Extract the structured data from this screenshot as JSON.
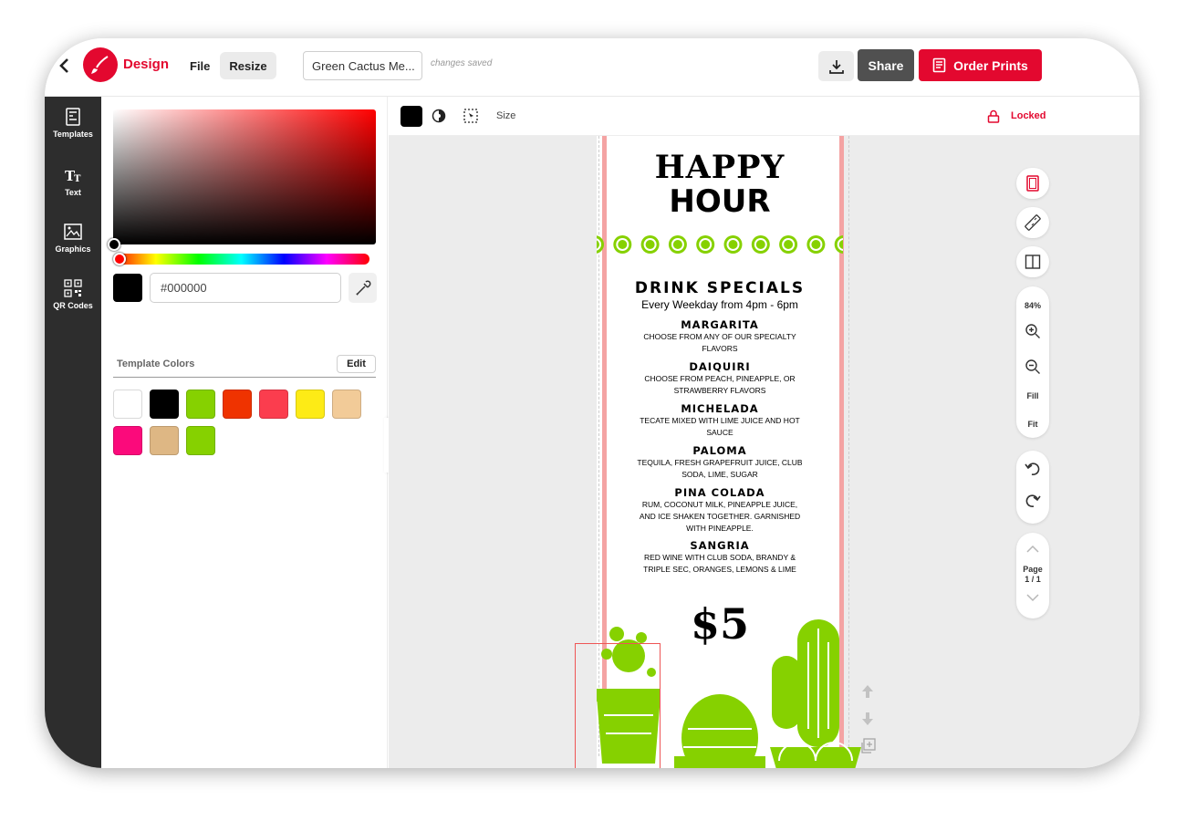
{
  "header": {
    "app_label": "Design",
    "file_label": "File",
    "resize_label": "Resize",
    "document_name": "Green Cactus Me...",
    "save_status": "changes saved",
    "share_label": "Share",
    "order_label": "Order Prints"
  },
  "sidebar": {
    "items": [
      {
        "label": "Templates",
        "icon": "templates-icon"
      },
      {
        "label": "Text",
        "icon": "text-icon"
      },
      {
        "label": "Graphics",
        "icon": "graphics-icon"
      },
      {
        "label": "QR Codes",
        "icon": "qr-code-icon"
      }
    ]
  },
  "color_panel": {
    "hex_value": "#000000",
    "current_color": "#000000",
    "template_colors_label": "Template Colors",
    "edit_label": "Edit",
    "template_colors": [
      "#ffffff",
      "#000000",
      "#86d100",
      "#ef3300",
      "#fb3d4e",
      "#fdeb16",
      "#f2cb98",
      "#fb0a7b",
      "#deb784",
      "#86d100"
    ]
  },
  "toolbar": {
    "size_label": "Size",
    "locked_label": "Locked"
  },
  "zoom": {
    "level": "84%",
    "fill_label": "Fill",
    "fit_label": "Fit",
    "page_label": "Page",
    "page_count": "1 / 1"
  },
  "menu": {
    "title_line1": "HAPPY",
    "title_line2": "HOUR",
    "heading": "DRINK SPECIALS",
    "subheading": "Every Weekday from 4pm - 6pm",
    "drinks": [
      {
        "name": "MARGARITA",
        "desc": "CHOOSE FROM ANY OF OUR SPECIALTY FLAVORS"
      },
      {
        "name": "DAIQUIRI",
        "desc": "CHOOSE FROM PEACH, PINEAPPLE, OR STRAWBERRY FLAVORS"
      },
      {
        "name": "MICHELADA",
        "desc": "TECATE MIXED WITH LIME JUICE AND HOT SAUCE"
      },
      {
        "name": "PALOMA",
        "desc": "TEQUILA, FRESH GRAPEFRUIT JUICE, CLUB SODA, LIME, SUGAR"
      },
      {
        "name": "PINA COLADA",
        "desc": "RUM, COCONUT MILK, PINEAPPLE JUICE, AND ICE SHAKEN TOGETHER. GARNISHED WITH PINEAPPLE."
      },
      {
        "name": "SANGRIA",
        "desc": "RED WINE WITH CLUB SODA, BRANDY & TRIPLE SEC, ORANGES, LEMONS & LIME"
      }
    ],
    "price": "$5"
  },
  "colors": {
    "brand": "#e3082f",
    "cactus_green": "#86d100",
    "guide_pink": "#f4a3a3"
  }
}
